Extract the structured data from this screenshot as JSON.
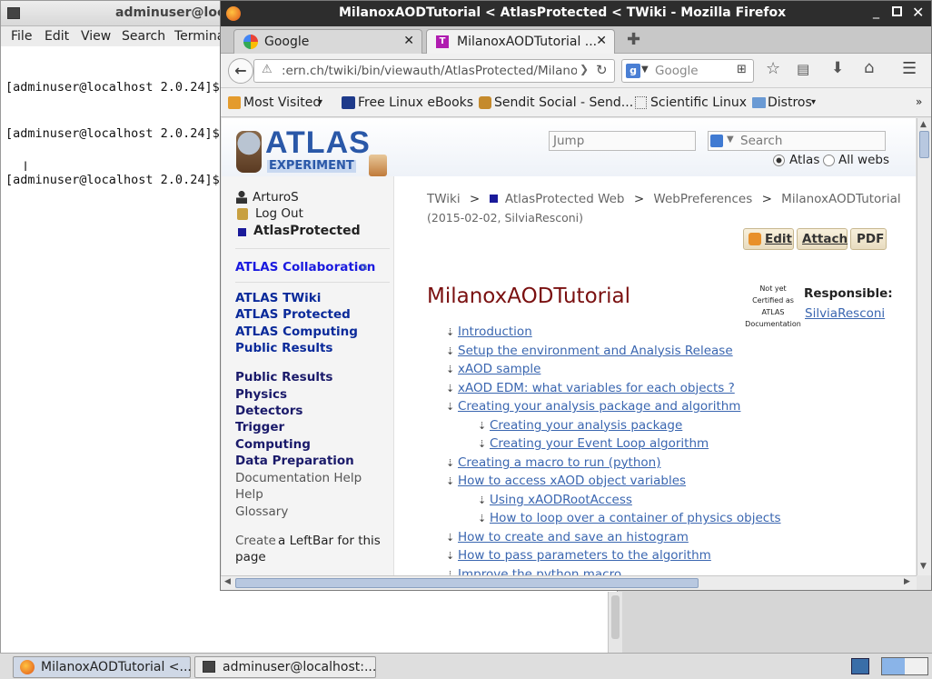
{
  "terminal": {
    "title": "adminuser@localhost",
    "menu": [
      "File",
      "Edit",
      "View",
      "Search",
      "Terminal"
    ],
    "lines": [
      "[adminuser@localhost 2.0.24]$",
      "[adminuser@localhost 2.0.24]$",
      "[adminuser@localhost 2.0.24]$"
    ]
  },
  "firefox": {
    "title": "MilanoxAODTutorial < AtlasProtected < TWiki - Mozilla Firefox",
    "tabs": [
      {
        "label": "Google"
      },
      {
        "label": "MilanoxAODTutorial ..."
      }
    ],
    "url": ":ern.ch/twiki/bin/viewauth/AtlasProtected/MilanoxAC",
    "search_placeholder": "Google",
    "bookmarks": [
      "Most Visited",
      "Free Linux eBooks",
      "Sendit Social - Send...",
      "Scientific Linux",
      "Distros"
    ]
  },
  "twiki": {
    "logo_line1": "ATLAS",
    "logo_line2": "EXPERIMENT",
    "jump_placeholder": "Jump",
    "search_placeholder": "Search",
    "scope_atlas": "Atlas",
    "scope_all": "All webs",
    "user": "ArturoS",
    "logout": "Log Out",
    "web": "AtlasProtected",
    "collab": "ATLAS Collaboration",
    "group1": [
      "ATLAS TWiki",
      "ATLAS Protected",
      "ATLAS Computing",
      "Public Results"
    ],
    "group2": [
      "Public Results",
      "Physics",
      "Detectors",
      "Trigger",
      "Computing",
      "Data Preparation"
    ],
    "group3": [
      "Documentation Help",
      "Help",
      "Glossary"
    ],
    "create1": "Create",
    "create2": "a LeftBar for this",
    "create3": "page",
    "breadcrumb": {
      "twiki": "TWiki",
      "sep": ">",
      "web": "AtlasProtected Web",
      "prefs": "WebPreferences",
      "topic": "MilanoxAODTutorial"
    },
    "revision": "(2015-02-02,",
    "revauthor": "SilviaResconi",
    "revclose": ")",
    "actions": {
      "edit": "Edit",
      "attach": "Attach",
      "pdf": "PDF"
    },
    "page_title": "MilanoxAODTutorial",
    "cert": [
      "Not yet",
      "Certified as",
      "ATLAS",
      "Documentation"
    ],
    "responsible_label": "Responsible:",
    "responsible": "SilviaResconi",
    "toc": [
      {
        "t": "Introduction",
        "l": 1
      },
      {
        "t": "Setup the environment and Analysis Release",
        "l": 1
      },
      {
        "t": "xAOD sample",
        "l": 1
      },
      {
        "t": "xAOD EDM: what variables for each objects ?",
        "l": 1
      },
      {
        "t": "Creating your analysis package and algorithm",
        "l": 1
      },
      {
        "t": "Creating your analysis package",
        "l": 2
      },
      {
        "t": "Creating your Event Loop algorithm",
        "l": 2
      },
      {
        "t": "Creating a macro to run (python)",
        "l": 1
      },
      {
        "t": "How to access xAOD object variables",
        "l": 1
      },
      {
        "t": "Using xAODRootAccess",
        "l": 2
      },
      {
        "t": "How to loop over a container of physics objects",
        "l": 2
      },
      {
        "t": "How to create and save an histogram",
        "l": 1
      },
      {
        "t": "How to pass parameters to the algorithm",
        "l": 1
      },
      {
        "t": "Improve the python macro",
        "l": 1
      }
    ]
  },
  "taskbar": [
    "MilanoxAODTutorial <...",
    "adminuser@localhost:..."
  ]
}
